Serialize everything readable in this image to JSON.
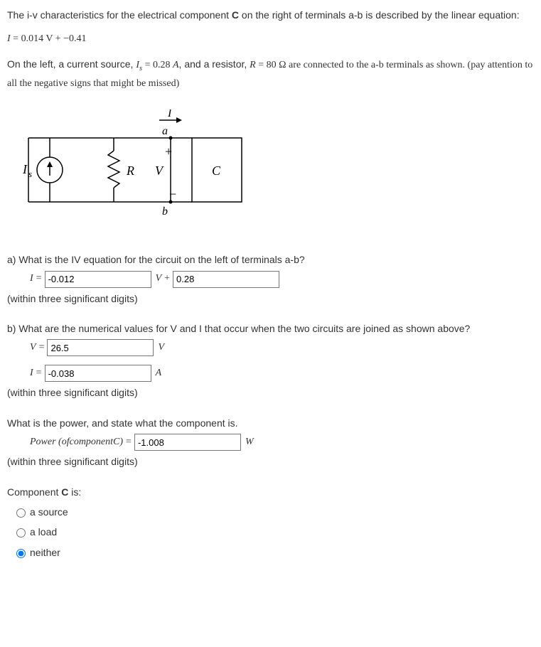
{
  "intro": {
    "p1_a": "The i-v characteristics for the electrical component ",
    "p1_b": "C",
    "p1_c": " on the right of terminals a-b is described by the linear equation:",
    "eq1_lhs": "I",
    "eq1_eq": " = ",
    "eq1_rhs": "0.014 V + −0.41",
    "p2_a": "On the left, a current source, ",
    "p2_is": "I",
    "p2_is_sub": "s",
    "p2_b": " = 0.28 ",
    "p2_a_unit": "A",
    "p2_c": ", and a resistor, ",
    "p2_r": "R",
    "p2_d": " = 80 Ω are connected to the a-b terminals as shown. (pay attention to all the negative signs that might be missed)"
  },
  "circuit": {
    "Is": "I",
    "Is_sub": "s",
    "R": "R",
    "V": "V",
    "C": "C",
    "a": "a",
    "b": "b",
    "I": "I",
    "plus": "+",
    "minus": "−"
  },
  "partA": {
    "question": "a) What is the IV equation for the circuit on the left of terminals a-b?",
    "I": "I",
    "eq": " = ",
    "slope_value": "-0.012",
    "V": "V",
    "plus": "+",
    "intercept_value": "0.28",
    "note": "(within three significant digits)"
  },
  "partB": {
    "question": "b) What are the numerical values for V and I that occur when the two circuits are joined as shown above?",
    "V": "V",
    "eq": " = ",
    "v_value": "26.5",
    "v_unit": "V",
    "I": "I",
    "i_value": "-0.038",
    "i_unit": "A",
    "note": "(within three significant digits)"
  },
  "partPower": {
    "question": "What is the power, and state what the component is.",
    "power_label": "Power (ofcomponentC)",
    "eq": " = ",
    "power_value": "-1.008",
    "power_unit": "W",
    "note": "(within three significant digits)"
  },
  "componentC": {
    "label": "Component ",
    "bold": "C",
    "suffix": " is:",
    "options": {
      "source": "a source",
      "load": "a load",
      "neither": "neither"
    },
    "selected": "neither"
  }
}
